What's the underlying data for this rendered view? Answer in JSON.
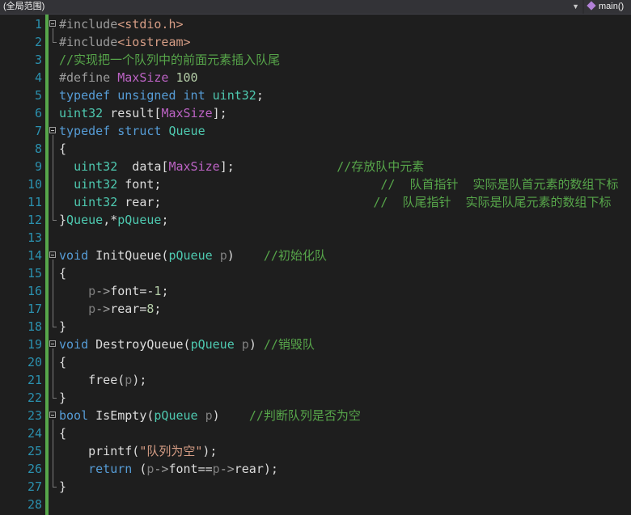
{
  "navbar": {
    "scope_label": "(全局范围)",
    "member_label": "main()"
  },
  "editor": {
    "lines": [
      {
        "n": "1",
        "segs": [
          {
            "c": "pp",
            "t": "#include"
          },
          {
            "c": "inc",
            "t": "<stdio.h>"
          }
        ]
      },
      {
        "n": "2",
        "segs": [
          {
            "c": "pp",
            "t": "#include"
          },
          {
            "c": "inc",
            "t": "<iostream>"
          }
        ]
      },
      {
        "n": "3",
        "segs": [
          {
            "c": "cm",
            "t": "//实现把一个队列中的前面元素插入队尾"
          }
        ]
      },
      {
        "n": "4",
        "segs": [
          {
            "c": "pp",
            "t": "#define "
          },
          {
            "c": "mac",
            "t": "MaxSize"
          },
          {
            "c": "pl",
            "t": " "
          },
          {
            "c": "num",
            "t": "100"
          }
        ]
      },
      {
        "n": "5",
        "segs": [
          {
            "c": "kw",
            "t": "typedef"
          },
          {
            "c": "pl",
            "t": " "
          },
          {
            "c": "kw",
            "t": "unsigned"
          },
          {
            "c": "pl",
            "t": " "
          },
          {
            "c": "kw",
            "t": "int"
          },
          {
            "c": "pl",
            "t": " "
          },
          {
            "c": "typ",
            "t": "uint32"
          },
          {
            "c": "pl",
            "t": ";"
          }
        ]
      },
      {
        "n": "6",
        "segs": [
          {
            "c": "typ",
            "t": "uint32"
          },
          {
            "c": "pl",
            "t": " result["
          },
          {
            "c": "mac",
            "t": "MaxSize"
          },
          {
            "c": "pl",
            "t": "];"
          }
        ]
      },
      {
        "n": "7",
        "segs": [
          {
            "c": "kw",
            "t": "typedef"
          },
          {
            "c": "pl",
            "t": " "
          },
          {
            "c": "kw",
            "t": "struct"
          },
          {
            "c": "pl",
            "t": " "
          },
          {
            "c": "typ",
            "t": "Queue"
          }
        ]
      },
      {
        "n": "8",
        "segs": [
          {
            "c": "pl",
            "t": "{"
          }
        ]
      },
      {
        "n": "9",
        "segs": [
          {
            "c": "pl",
            "t": "  "
          },
          {
            "c": "typ",
            "t": "uint32"
          },
          {
            "c": "pl",
            "t": "  data["
          },
          {
            "c": "mac",
            "t": "MaxSize"
          },
          {
            "c": "pl",
            "t": "];              "
          },
          {
            "c": "cm",
            "t": "//存放队中元素"
          }
        ]
      },
      {
        "n": "10",
        "segs": [
          {
            "c": "pl",
            "t": "  "
          },
          {
            "c": "typ",
            "t": "uint32"
          },
          {
            "c": "pl",
            "t": " font;                              "
          },
          {
            "c": "cm",
            "t": "//  队首指针  实际是队首元素的数组下标"
          }
        ]
      },
      {
        "n": "11",
        "segs": [
          {
            "c": "pl",
            "t": "  "
          },
          {
            "c": "typ",
            "t": "uint32"
          },
          {
            "c": "pl",
            "t": " rear;                             "
          },
          {
            "c": "cm",
            "t": "//  队尾指针  实际是队尾元素的数组下标"
          }
        ]
      },
      {
        "n": "12",
        "segs": [
          {
            "c": "pl",
            "t": "}"
          },
          {
            "c": "typ",
            "t": "Queue"
          },
          {
            "c": "pl",
            "t": ",*"
          },
          {
            "c": "typ",
            "t": "pQueue"
          },
          {
            "c": "pl",
            "t": ";"
          }
        ]
      },
      {
        "n": "13",
        "segs": []
      },
      {
        "n": "14",
        "segs": [
          {
            "c": "kw",
            "t": "void"
          },
          {
            "c": "pl",
            "t": " InitQueue("
          },
          {
            "c": "typ",
            "t": "pQueue"
          },
          {
            "c": "pl",
            "t": " "
          },
          {
            "c": "par",
            "t": "p"
          },
          {
            "c": "pl",
            "t": ")    "
          },
          {
            "c": "cm",
            "t": "//初始化队"
          }
        ]
      },
      {
        "n": "15",
        "segs": [
          {
            "c": "pl",
            "t": "{"
          }
        ]
      },
      {
        "n": "16",
        "segs": [
          {
            "c": "pl",
            "t": "    "
          },
          {
            "c": "par",
            "t": "p"
          },
          {
            "c": "dim",
            "t": "->"
          },
          {
            "c": "pl",
            "t": "font=-"
          },
          {
            "c": "num",
            "t": "1"
          },
          {
            "c": "pl",
            "t": ";"
          }
        ]
      },
      {
        "n": "17",
        "segs": [
          {
            "c": "pl",
            "t": "    "
          },
          {
            "c": "par",
            "t": "p"
          },
          {
            "c": "dim",
            "t": "->"
          },
          {
            "c": "pl",
            "t": "rear="
          },
          {
            "c": "num",
            "t": "8"
          },
          {
            "c": "pl",
            "t": ";"
          }
        ]
      },
      {
        "n": "18",
        "segs": [
          {
            "c": "pl",
            "t": "}"
          }
        ]
      },
      {
        "n": "19",
        "segs": [
          {
            "c": "kw",
            "t": "void"
          },
          {
            "c": "pl",
            "t": " DestroyQueue("
          },
          {
            "c": "typ",
            "t": "pQueue"
          },
          {
            "c": "pl",
            "t": " "
          },
          {
            "c": "par",
            "t": "p"
          },
          {
            "c": "pl",
            "t": ") "
          },
          {
            "c": "cm",
            "t": "//销毁队"
          }
        ]
      },
      {
        "n": "20",
        "segs": [
          {
            "c": "pl",
            "t": "{"
          }
        ]
      },
      {
        "n": "21",
        "segs": [
          {
            "c": "pl",
            "t": "    free("
          },
          {
            "c": "par",
            "t": "p"
          },
          {
            "c": "pl",
            "t": ");"
          }
        ]
      },
      {
        "n": "22",
        "segs": [
          {
            "c": "pl",
            "t": "}"
          }
        ]
      },
      {
        "n": "23",
        "segs": [
          {
            "c": "kw",
            "t": "bool"
          },
          {
            "c": "pl",
            "t": " IsEmpty("
          },
          {
            "c": "typ",
            "t": "pQueue"
          },
          {
            "c": "pl",
            "t": " "
          },
          {
            "c": "par",
            "t": "p"
          },
          {
            "c": "pl",
            "t": ")    "
          },
          {
            "c": "cm",
            "t": "//判断队列是否为空"
          }
        ]
      },
      {
        "n": "24",
        "segs": [
          {
            "c": "pl",
            "t": "{"
          }
        ]
      },
      {
        "n": "25",
        "segs": [
          {
            "c": "pl",
            "t": "    printf("
          },
          {
            "c": "str",
            "t": "\"队列为空\""
          },
          {
            "c": "pl",
            "t": ");"
          }
        ]
      },
      {
        "n": "26",
        "segs": [
          {
            "c": "pl",
            "t": "    "
          },
          {
            "c": "kw",
            "t": "return"
          },
          {
            "c": "pl",
            "t": " ("
          },
          {
            "c": "par",
            "t": "p"
          },
          {
            "c": "dim",
            "t": "->"
          },
          {
            "c": "pl",
            "t": "font=="
          },
          {
            "c": "par",
            "t": "p"
          },
          {
            "c": "dim",
            "t": "->"
          },
          {
            "c": "pl",
            "t": "rear);"
          }
        ]
      },
      {
        "n": "27",
        "segs": [
          {
            "c": "pl",
            "t": "}"
          }
        ]
      },
      {
        "n": "28",
        "segs": []
      }
    ]
  }
}
